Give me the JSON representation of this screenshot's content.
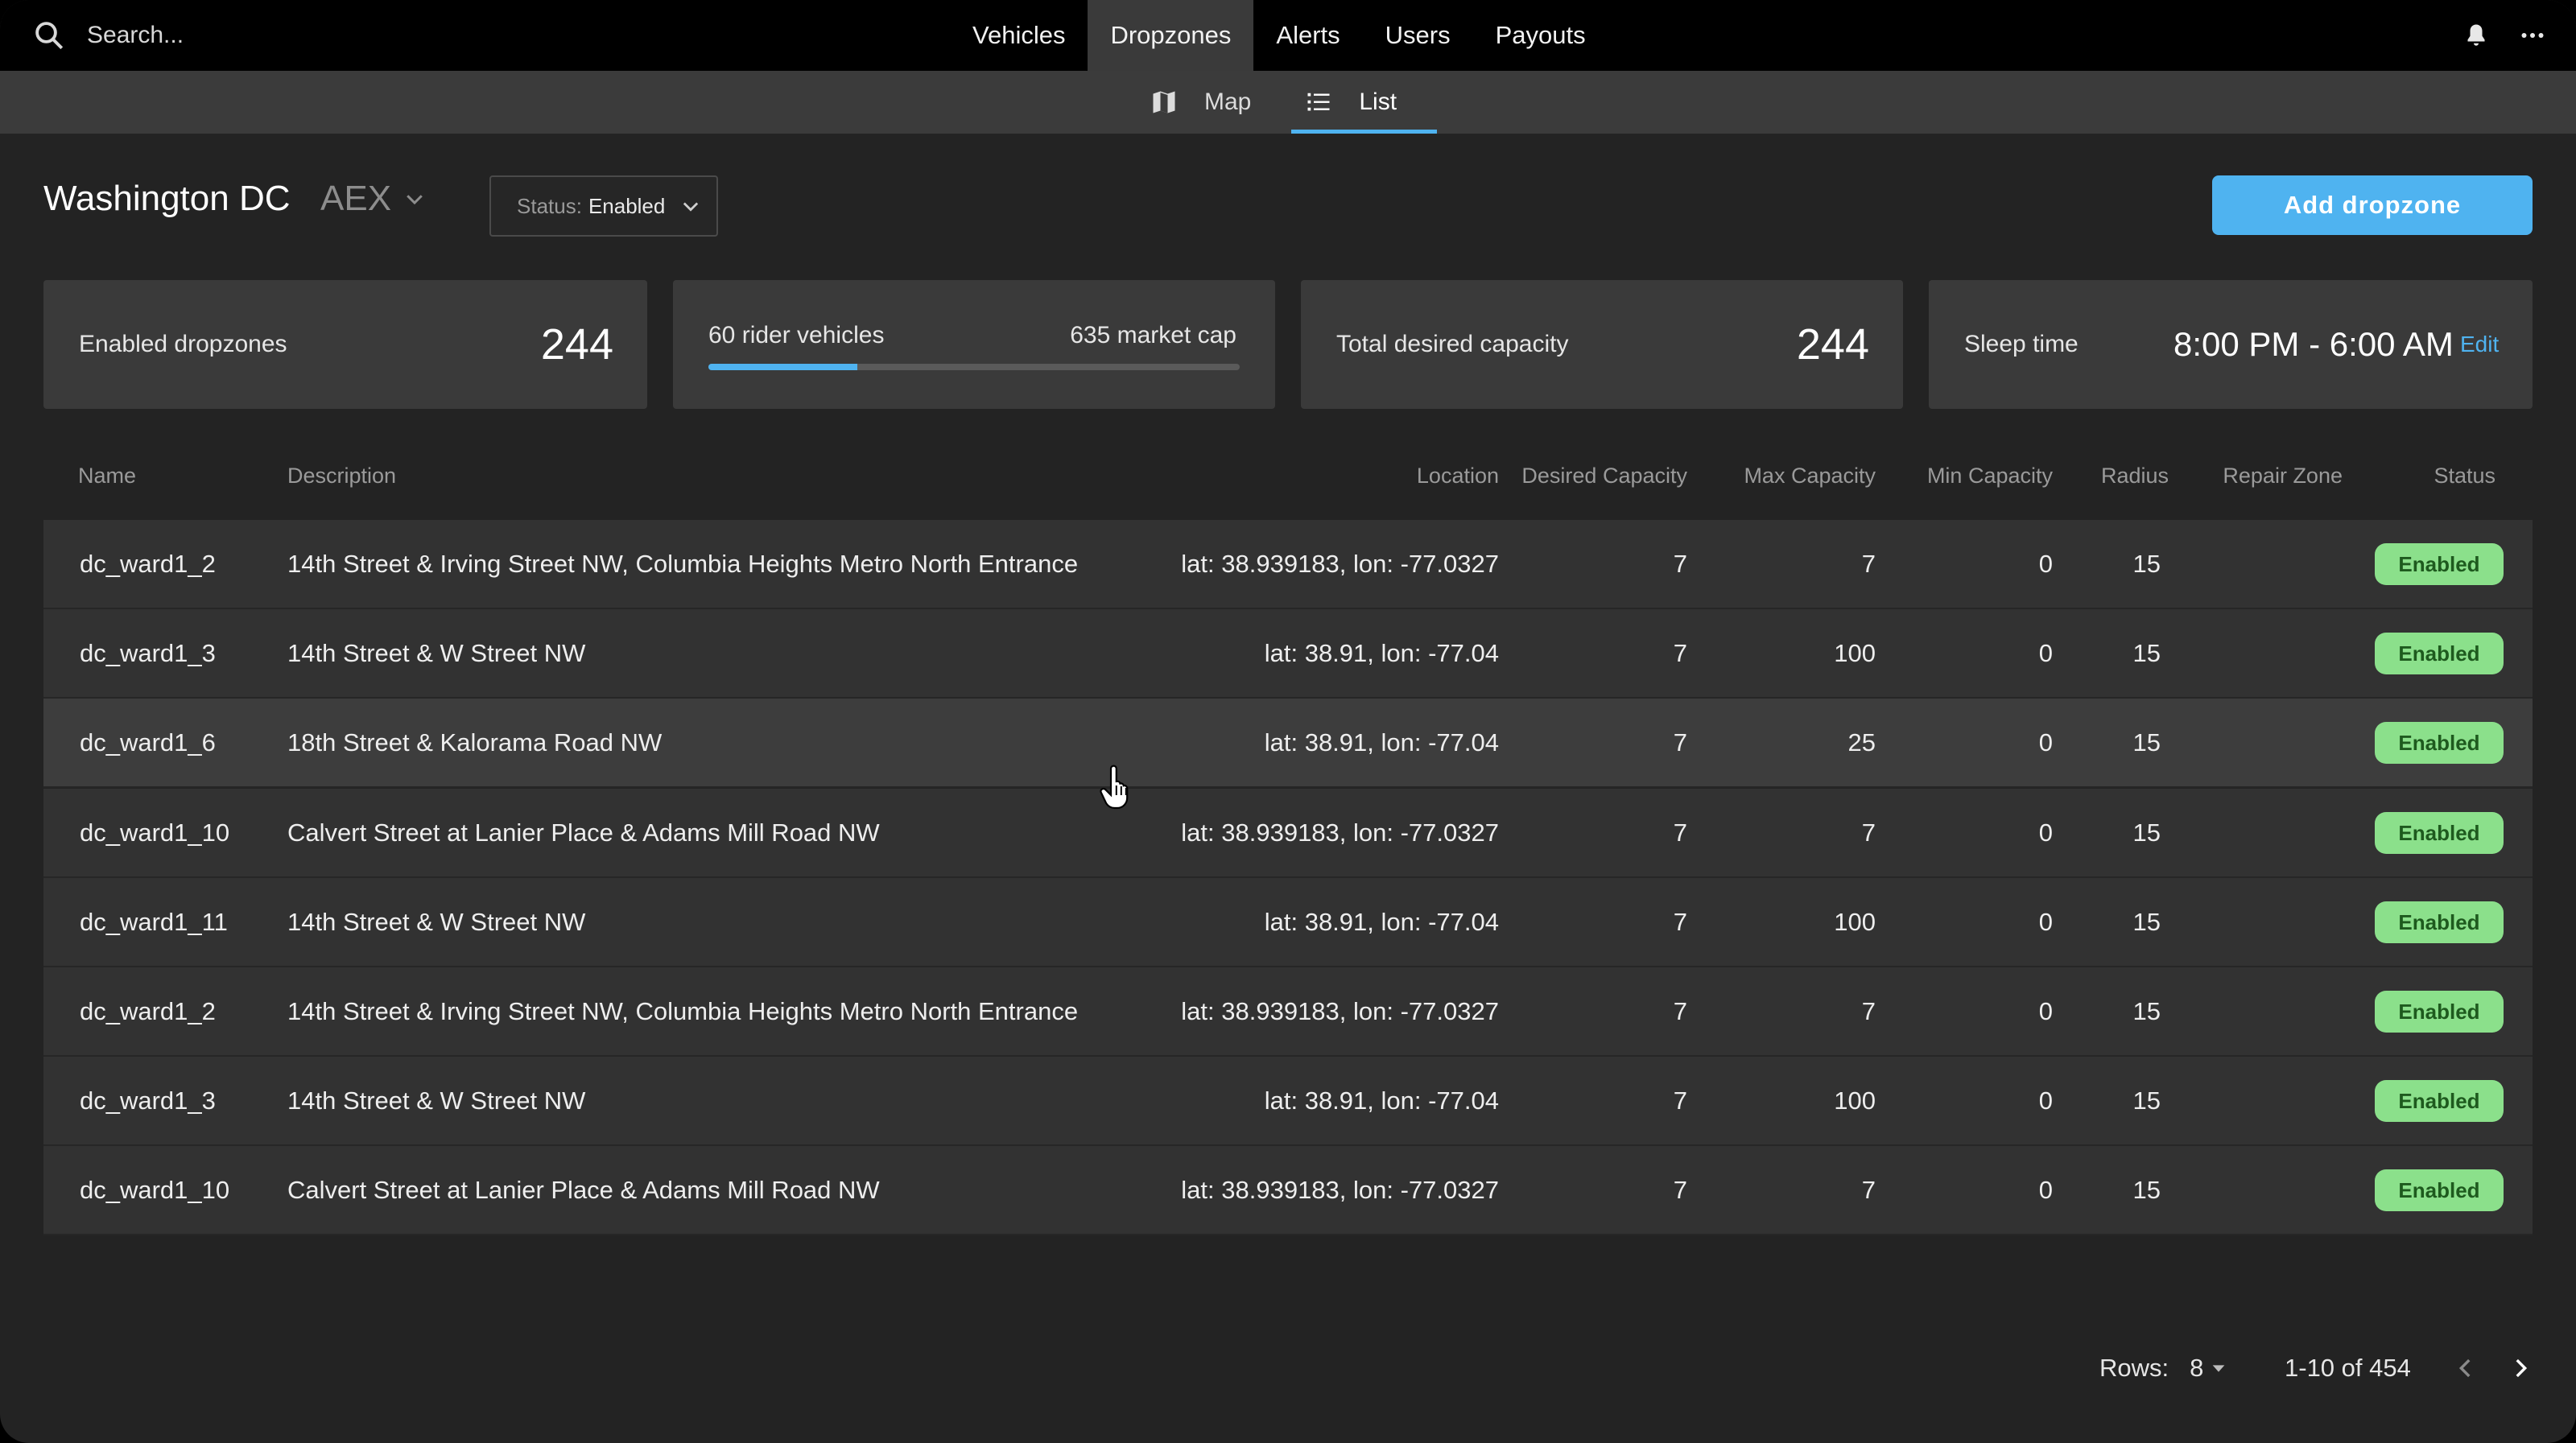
{
  "topbar": {
    "search_placeholder": "Search...",
    "nav": [
      "Vehicles",
      "Dropzones",
      "Alerts",
      "Users",
      "Payouts"
    ],
    "active_nav": "Dropzones"
  },
  "subnav": {
    "map_label": "Map",
    "list_label": "List",
    "active": "List"
  },
  "header": {
    "city": "Washington DC",
    "code": "AEX",
    "status_filter_label": "Status:",
    "status_filter_value": "Enabled",
    "add_button": "Add dropzone"
  },
  "stats": {
    "enabled_label": "Enabled dropzones",
    "enabled_value": "244",
    "rider_vehicles": "60 rider vehicles",
    "market_cap": "635 market cap",
    "rider_fraction": 0.28,
    "desired_label": "Total desired capacity",
    "desired_value": "244",
    "sleep_label": "Sleep time",
    "sleep_value": "8:00 PM - 6:00 AM",
    "edit_label": "Edit"
  },
  "table": {
    "columns": [
      "Name",
      "Description",
      "Location",
      "Desired Capacity",
      "Max Capacity",
      "Min Capacity",
      "Radius",
      "Repair Zone",
      "Status"
    ],
    "rows": [
      {
        "name": "dc_ward1_2",
        "description": "14th Street & Irving Street NW, Columbia Heights Metro North Entrance",
        "location": "lat: 38.939183, lon: -77.0327",
        "desired": "7",
        "max": "7",
        "min": "0",
        "radius": "15",
        "repair": "",
        "status": "Enabled"
      },
      {
        "name": "dc_ward1_3",
        "description": "14th Street & W Street NW",
        "location": "lat: 38.91, lon: -77.04",
        "desired": "7",
        "max": "100",
        "min": "0",
        "radius": "15",
        "repair": "",
        "status": "Enabled"
      },
      {
        "name": "dc_ward1_6",
        "description": "18th Street & Kalorama Road NW",
        "location": "lat: 38.91, lon: -77.04",
        "desired": "7",
        "max": "25",
        "min": "0",
        "radius": "15",
        "repair": "",
        "status": "Enabled"
      },
      {
        "name": "dc_ward1_10",
        "description": "Calvert Street at Lanier Place & Adams Mill Road NW",
        "location": "lat: 38.939183, lon: -77.0327",
        "desired": "7",
        "max": "7",
        "min": "0",
        "radius": "15",
        "repair": "",
        "status": "Enabled"
      },
      {
        "name": "dc_ward1_11",
        "description": "14th Street & W Street NW",
        "location": "lat: 38.91, lon: -77.04",
        "desired": "7",
        "max": "100",
        "min": "0",
        "radius": "15",
        "repair": "",
        "status": "Enabled"
      },
      {
        "name": "dc_ward1_2",
        "description": "14th Street & Irving Street NW, Columbia Heights Metro North Entrance",
        "location": "lat: 38.939183, lon: -77.0327",
        "desired": "7",
        "max": "7",
        "min": "0",
        "radius": "15",
        "repair": "",
        "status": "Enabled"
      },
      {
        "name": "dc_ward1_3",
        "description": "14th Street & W Street NW",
        "location": "lat: 38.91, lon: -77.04",
        "desired": "7",
        "max": "100",
        "min": "0",
        "radius": "15",
        "repair": "",
        "status": "Enabled"
      },
      {
        "name": "dc_ward1_10",
        "description": "Calvert Street at Lanier Place & Adams Mill Road NW",
        "location": "lat: 38.939183, lon: -77.0327",
        "desired": "7",
        "max": "7",
        "min": "0",
        "radius": "15",
        "repair": "",
        "status": "Enabled"
      }
    ]
  },
  "pagination": {
    "rows_label": "Rows:",
    "rows_value": "8",
    "range": "1-10 of 454"
  },
  "colors": {
    "accent": "#4fb3f0",
    "badge_bg": "#8be08b",
    "badge_text": "#1e5a1e"
  }
}
